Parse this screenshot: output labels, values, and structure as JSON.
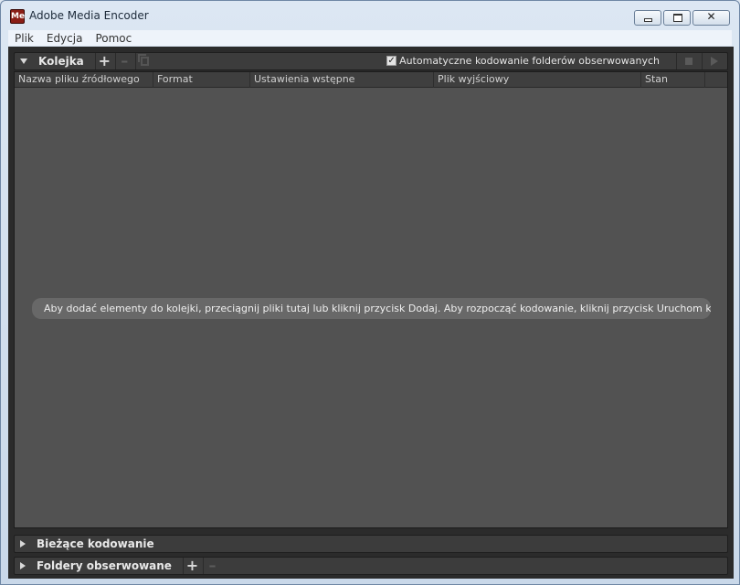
{
  "window": {
    "title": "Adobe Media Encoder",
    "icon": "adobe-media-encoder-icon"
  },
  "menu": [
    "Plik",
    "Edycja",
    "Pomoc"
  ],
  "queue_panel": {
    "title": "Kolejka",
    "add_icon": "plus-icon",
    "remove_icon": "minus-icon",
    "duplicate_icon": "duplicate-icon",
    "auto_encode_checked": true,
    "auto_encode_label": "Automatyczne kodowanie folderów obserwowanych",
    "columns": [
      "Nazwa pliku źródłowego",
      "Format",
      "Ustawienia wstępne",
      "Plik wyjściowy",
      "Stan"
    ],
    "empty_hint": "Aby dodać elementy do kolejki, przeciągnij pliki tutaj lub kliknij przycisk Dodaj. Aby rozpocząć kodowanie, kliknij przycisk Uruchom kolejkę."
  },
  "current_encoding_panel": {
    "title": "Bieżące kodowanie"
  },
  "watch_folders_panel": {
    "title": "Foldery obserwowane"
  }
}
